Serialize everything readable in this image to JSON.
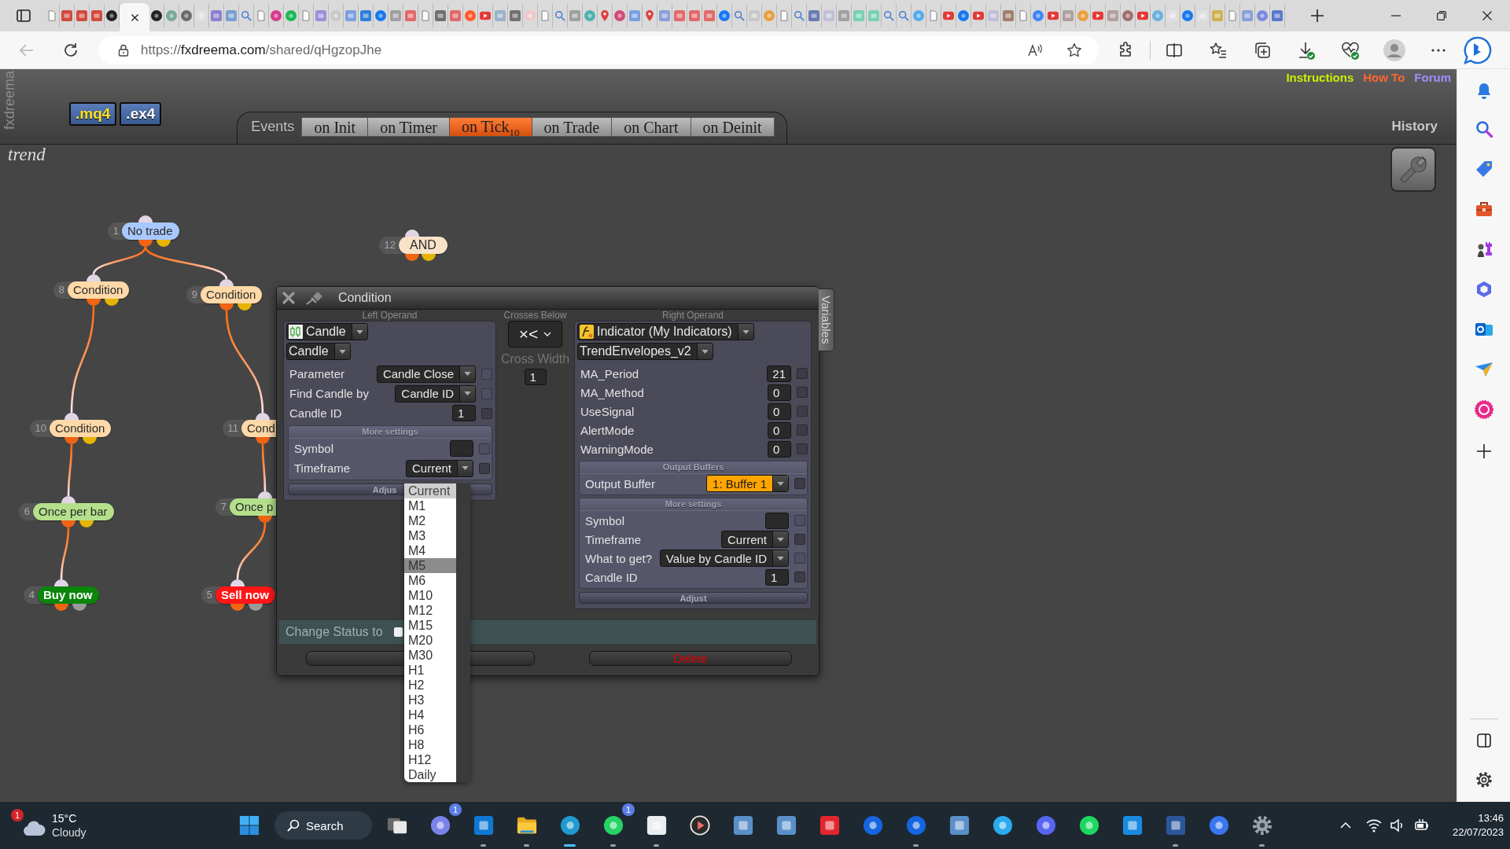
{
  "browser": {
    "tabs": [
      {
        "kind": "page",
        "selected": false
      },
      {
        "kind": "tile",
        "color": "#d24a3e",
        "selected": false
      },
      {
        "kind": "tile",
        "color": "#d24a3e",
        "selected": false
      },
      {
        "kind": "tile",
        "color": "#d24a3e",
        "selected": false
      },
      {
        "kind": "round",
        "color": "#222222",
        "selected": false
      },
      {
        "selected": true
      },
      {
        "kind": "round",
        "color": "#222222",
        "selected": false
      },
      {
        "kind": "round",
        "color": "#7aa89a",
        "selected": false
      },
      {
        "kind": "round",
        "color": "#6b6b6b",
        "selected": false
      },
      {
        "kind": "round",
        "color": "#e2e2e2",
        "selected": false
      },
      {
        "kind": "tile",
        "color": "#8a7fd0",
        "selected": false
      },
      {
        "kind": "tile",
        "color": "#7aa0d0",
        "selected": false
      },
      {
        "kind": "search",
        "selected": false
      },
      {
        "kind": "page",
        "selected": false
      },
      {
        "kind": "round",
        "color": "#d83a8a",
        "selected": false
      },
      {
        "kind": "round",
        "color": "#1db954",
        "selected": false
      },
      {
        "kind": "page",
        "selected": false
      },
      {
        "kind": "tile",
        "color": "#9a90d8",
        "selected": false
      },
      {
        "kind": "round",
        "color": "#c8c8c8",
        "selected": false
      },
      {
        "kind": "tile",
        "color": "#7aa0e0",
        "selected": false
      },
      {
        "kind": "tile",
        "color": "#2f7fd8",
        "selected": false
      },
      {
        "kind": "round",
        "color": "#1877f2",
        "selected": false
      },
      {
        "kind": "tile",
        "color": "#a0a0a0",
        "selected": false
      },
      {
        "kind": "tile",
        "color": "#e06a6a",
        "selected": false
      },
      {
        "kind": "page",
        "selected": false
      },
      {
        "kind": "tile",
        "color": "#707070",
        "selected": false
      },
      {
        "kind": "tile",
        "color": "#e06a6a",
        "selected": false
      },
      {
        "kind": "round",
        "color": "#ff5a2a",
        "selected": false
      },
      {
        "kind": "play",
        "selected": false
      },
      {
        "kind": "tile",
        "color": "#9ab0c8",
        "selected": false
      },
      {
        "kind": "tile",
        "color": "#707070",
        "selected": false
      },
      {
        "kind": "round",
        "color": "#f0c8c8",
        "selected": false
      },
      {
        "kind": "page",
        "selected": false
      },
      {
        "kind": "search",
        "selected": false
      },
      {
        "kind": "tile",
        "color": "#a0a0a0",
        "selected": false
      },
      {
        "kind": "round",
        "color": "#50b0b0",
        "selected": false
      },
      {
        "kind": "pin",
        "color": "#e04040",
        "selected": false
      },
      {
        "kind": "round",
        "color": "#d04a7a",
        "selected": false
      },
      {
        "kind": "tile",
        "color": "#7aa0e0",
        "selected": false
      },
      {
        "kind": "pin",
        "color": "#e04040",
        "selected": false
      },
      {
        "kind": "tile",
        "color": "#8aa0d8",
        "selected": false
      },
      {
        "kind": "tile",
        "color": "#e06a6a",
        "selected": false
      },
      {
        "kind": "tile",
        "color": "#e06a6a",
        "selected": false
      },
      {
        "kind": "tile",
        "color": "#e06a6a",
        "selected": false
      },
      {
        "kind": "round",
        "color": "#1877f2",
        "selected": false
      },
      {
        "kind": "search",
        "selected": false
      },
      {
        "kind": "tile",
        "color": "#c8c8c8",
        "selected": false
      },
      {
        "kind": "round",
        "color": "#e8a040",
        "selected": false
      },
      {
        "kind": "page",
        "selected": false
      },
      {
        "kind": "search",
        "selected": false
      },
      {
        "kind": "tile",
        "color": "#6a7ab0",
        "selected": false
      },
      {
        "kind": "tile",
        "color": "#c0c0d8",
        "selected": false
      },
      {
        "kind": "tile",
        "color": "#a0a0a0",
        "selected": false
      },
      {
        "kind": "tile",
        "color": "#7ad0b0",
        "selected": false
      },
      {
        "kind": "tile",
        "color": "#7ad0b0",
        "selected": false
      },
      {
        "kind": "search",
        "selected": false
      },
      {
        "kind": "search",
        "selected": false
      },
      {
        "kind": "round",
        "color": "#55acee",
        "selected": false
      },
      {
        "kind": "page",
        "selected": false
      },
      {
        "kind": "play",
        "selected": false
      },
      {
        "kind": "round",
        "color": "#1877f2",
        "selected": false
      },
      {
        "kind": "play",
        "selected": false
      },
      {
        "kind": "tile",
        "color": "#c0c0d8",
        "selected": false
      },
      {
        "kind": "tile",
        "color": "#a08070",
        "selected": false
      },
      {
        "kind": "page",
        "selected": false
      },
      {
        "kind": "round",
        "color": "#4285f4",
        "selected": false
      },
      {
        "kind": "play",
        "selected": false
      },
      {
        "kind": "tile",
        "color": "#b0a0a0",
        "selected": false
      },
      {
        "kind": "round",
        "color": "#e8a040",
        "selected": false
      },
      {
        "kind": "play",
        "selected": false
      },
      {
        "kind": "tile",
        "color": "#b0a0a0",
        "selected": false
      },
      {
        "kind": "round",
        "color": "#a07070",
        "selected": false
      },
      {
        "kind": "play",
        "selected": false
      },
      {
        "kind": "round",
        "color": "#6ab0e0",
        "selected": false
      },
      {
        "kind": "tile",
        "color": "#e0e0e0",
        "selected": false
      },
      {
        "kind": "round",
        "color": "#1877f2",
        "selected": false
      },
      {
        "kind": "tile",
        "color": "#e0e0e0",
        "selected": false
      },
      {
        "kind": "tile",
        "color": "#d0b050",
        "selected": false
      },
      {
        "kind": "page",
        "selected": false
      },
      {
        "kind": "tile",
        "color": "#8aa0d8",
        "selected": false
      },
      {
        "kind": "round",
        "color": "#7a8ae0",
        "selected": false
      },
      {
        "kind": "tile",
        "color": "#5a7ac8",
        "selected": false
      }
    ],
    "address": {
      "scheme": "https://",
      "host": "fxdreema.com",
      "path": "/shared/qHgzopJhe"
    }
  },
  "app": {
    "side_label": "fxdreema",
    "export_buttons": [
      {
        "label": ".mq4",
        "kind": "source"
      },
      {
        "label": ".ex4",
        "kind": "compiled"
      }
    ],
    "events_label": "Events",
    "event_tabs": [
      {
        "label": "on Init",
        "selected": false
      },
      {
        "label": "on Timer",
        "selected": false
      },
      {
        "label": "on Tick",
        "count": "10",
        "selected": true
      },
      {
        "label": "on Trade",
        "selected": false
      },
      {
        "label": "on Chart",
        "selected": false
      },
      {
        "label": "on Deinit",
        "selected": false
      }
    ],
    "links": [
      {
        "label": "Instructions",
        "color": "#c5f000"
      },
      {
        "label": "How To",
        "color": "#ff6633"
      },
      {
        "label": "Forum",
        "color": "#9d8fff"
      }
    ],
    "history_label": "History",
    "project_name": "trend"
  },
  "diagram": {
    "nodes": [
      {
        "number": "1",
        "label": "No trade",
        "kind": "start",
        "children": [
          {
            "number": "8",
            "label": "Condition",
            "kind": "condition",
            "children": [
              {
                "number": "10",
                "label": "Condition",
                "kind": "condition",
                "children": [
                  {
                    "number": "6",
                    "label": "Once per bar",
                    "kind": "filter",
                    "children": [
                      {
                        "number": "4",
                        "label": "Buy now",
                        "kind": "buy"
                      }
                    ]
                  }
                ]
              }
            ]
          },
          {
            "number": "9",
            "label": "Condition",
            "kind": "condition",
            "children": [
              {
                "number": "11",
                "label": "Cond",
                "kind": "condition",
                "children": [
                  {
                    "number": "7",
                    "label": "Once p",
                    "kind": "filter",
                    "children": [
                      {
                        "number": "5",
                        "label": "Sell now",
                        "kind": "sell"
                      }
                    ]
                  }
                ]
              }
            ]
          }
        ]
      },
      {
        "number": "12",
        "label": "AND",
        "kind": "and"
      }
    ]
  },
  "dialog": {
    "title": "Condition",
    "side_tab": "Variables",
    "left_operand": {
      "heading": "Left Operand",
      "type": {
        "label": "Candle",
        "kind": "candle"
      },
      "subtype": "Candle",
      "fields": [
        {
          "label": "Parameter",
          "kind": "select",
          "value": "Candle Close",
          "checked": false,
          "check_disabled": true
        },
        {
          "label": "Find Candle by",
          "kind": "select",
          "value": "Candle ID",
          "checked": false,
          "check_disabled": true
        },
        {
          "label": "Candle ID",
          "kind": "input",
          "value": "1",
          "checked": false,
          "check_disabled": false
        }
      ],
      "more_settings": {
        "heading": "More settings",
        "fields": [
          {
            "label": "Symbol",
            "kind": "input",
            "checked": false,
            "check_disabled": true
          },
          {
            "label": "Timeframe",
            "kind": "select",
            "value": "Current",
            "checked": false,
            "check_disabled": false
          }
        ]
      },
      "adjust": "Adjus"
    },
    "operator": {
      "heading": "Crosses Below",
      "symbol": "×<",
      "width_label": "Cross Width",
      "width_value": "1"
    },
    "right_operand": {
      "heading": "Right Operand",
      "type": {
        "label": "Indicator (My Indicators)",
        "kind": "indicator"
      },
      "subtype": "TrendEnvelopes_v2",
      "fields": [
        {
          "label": "MA_Period",
          "kind": "input",
          "value": "21",
          "checked": false,
          "check_disabled": false
        },
        {
          "label": "MA_Method",
          "kind": "input",
          "value": "0",
          "checked": false,
          "check_disabled": false
        },
        {
          "label": "UseSignal",
          "kind": "input",
          "value": "0",
          "checked": false,
          "check_disabled": false
        },
        {
          "label": "AlertMode",
          "kind": "input",
          "value": "0",
          "checked": false,
          "check_disabled": false
        },
        {
          "label": "WarningMode",
          "kind": "input",
          "value": "0",
          "checked": false,
          "check_disabled": false
        }
      ],
      "output_buffers": {
        "heading": "Output Buffers",
        "fields": [
          {
            "label": "Output Buffer",
            "kind": "select",
            "value": "1: Buffer 1",
            "highlighted": true,
            "checked": false,
            "check_disabled": false
          }
        ]
      },
      "more_settings": {
        "heading": "More settings",
        "fields": [
          {
            "label": "Symbol",
            "kind": "input",
            "checked": false,
            "check_disabled": true
          },
          {
            "label": "Timeframe",
            "kind": "select",
            "value": "Current",
            "checked": false,
            "check_disabled": false
          },
          {
            "label": "What to get?",
            "kind": "select",
            "value": "Value by Candle ID",
            "checked": false,
            "check_disabled": true
          },
          {
            "label": "Candle ID",
            "kind": "input",
            "value": "1",
            "checked": false,
            "check_disabled": false
          }
        ]
      },
      "adjust": "Adjust"
    },
    "change_status": {
      "label": "Change Status to",
      "checked": false
    },
    "buttons": [
      {
        "kind": "save"
      },
      {
        "kind": "delete",
        "label": "Delete"
      }
    ],
    "timeframe_menu": {
      "options": [
        {
          "label": "Current",
          "selected": true,
          "highlighted": false
        },
        {
          "label": "M1",
          "selected": false,
          "highlighted": false
        },
        {
          "label": "M2",
          "selected": false,
          "highlighted": false
        },
        {
          "label": "M3",
          "selected": false,
          "highlighted": false
        },
        {
          "label": "M4",
          "selected": false,
          "highlighted": false
        },
        {
          "label": "M5",
          "selected": false,
          "highlighted": true
        },
        {
          "label": "M6",
          "selected": false,
          "highlighted": false
        },
        {
          "label": "M10",
          "selected": false,
          "highlighted": false
        },
        {
          "label": "M12",
          "selected": false,
          "highlighted": false
        },
        {
          "label": "M15",
          "selected": false,
          "highlighted": false
        },
        {
          "label": "M20",
          "selected": false,
          "highlighted": false
        },
        {
          "label": "M30",
          "selected": false,
          "highlighted": false
        },
        {
          "label": "H1",
          "selected": false,
          "highlighted": false
        },
        {
          "label": "H2",
          "selected": false,
          "highlighted": false
        },
        {
          "label": "H3",
          "selected": false,
          "highlighted": false
        },
        {
          "label": "H4",
          "selected": false,
          "highlighted": false
        },
        {
          "label": "H6",
          "selected": false,
          "highlighted": false
        },
        {
          "label": "H8",
          "selected": false,
          "highlighted": false
        },
        {
          "label": "H12",
          "selected": false,
          "highlighted": false
        },
        {
          "label": "Daily",
          "selected": false,
          "highlighted": false
        }
      ]
    }
  },
  "taskbar": {
    "weather": {
      "temperature": "15°C",
      "condition": "Cloudy",
      "badge": "1"
    },
    "apps": [
      {
        "kind": "windows",
        "running": false,
        "active": false
      },
      {
        "kind": "search",
        "label": "Search"
      },
      {
        "kind": "stack",
        "running": false,
        "active": false
      },
      {
        "kind": "round",
        "color": "#7b83eb",
        "badge": "1",
        "running": false,
        "active": false
      },
      {
        "kind": "tile",
        "color": "#0f78d4",
        "running": true,
        "active": false
      },
      {
        "kind": "folder",
        "running": true,
        "active": false
      },
      {
        "kind": "round",
        "color": "#1f9bd1",
        "running": true,
        "active": true
      },
      {
        "kind": "round",
        "color": "#25d366",
        "badge": "1",
        "running": true,
        "active": false
      },
      {
        "kind": "tile",
        "color": "#e9eef0",
        "running": true,
        "active": false
      },
      {
        "kind": "play",
        "running": false,
        "active": false
      },
      {
        "kind": "tile",
        "color": "#5b8fc9",
        "running": false,
        "active": false
      },
      {
        "kind": "tile",
        "color": "#5b8fc9",
        "running": false,
        "active": false
      },
      {
        "kind": "tile",
        "color": "#e3262e",
        "running": false,
        "active": false
      },
      {
        "kind": "round",
        "color": "#1565e0",
        "running": false,
        "active": false
      },
      {
        "kind": "round",
        "color": "#1565e0",
        "running": true,
        "active": false
      },
      {
        "kind": "tile",
        "color": "#5b8fc9",
        "running": false,
        "active": false
      },
      {
        "kind": "round",
        "color": "#2aabee",
        "running": false,
        "active": false
      },
      {
        "kind": "round",
        "color": "#5865f2",
        "running": false,
        "active": false
      },
      {
        "kind": "round",
        "color": "#1ed760",
        "running": false,
        "active": false
      },
      {
        "kind": "tile",
        "color": "#1a8ae0",
        "running": false,
        "active": false
      },
      {
        "kind": "tile",
        "color": "#2b579a",
        "running": true,
        "active": false
      },
      {
        "kind": "round",
        "color": "#3a76f0",
        "running": false,
        "active": false
      },
      {
        "kind": "gear",
        "running": true,
        "active": false
      }
    ],
    "time": "13:46",
    "date": "22/07/2023"
  }
}
